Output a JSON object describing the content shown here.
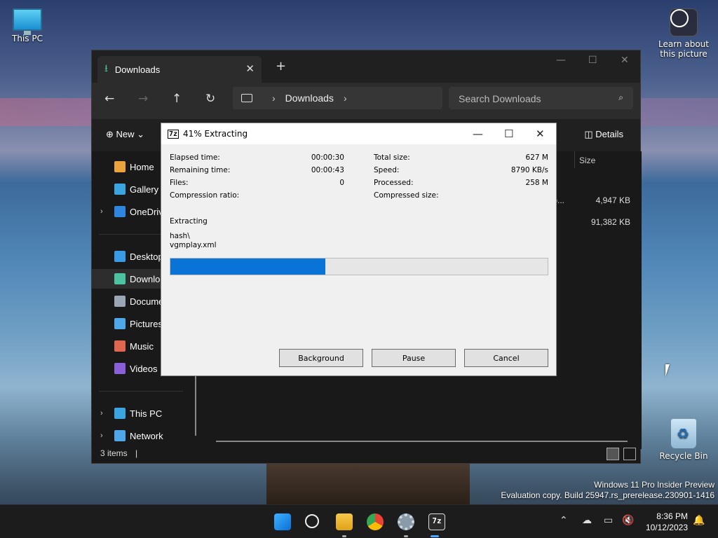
{
  "desktop": {
    "icons": {
      "this_pc": "This PC",
      "learn_about": "Learn about this picture",
      "recycle_bin": "Recycle Bin"
    }
  },
  "explorer": {
    "tab_title": "Downloads",
    "new_tab": "+",
    "address": {
      "segment": "Downloads"
    },
    "search_placeholder": "Search Downloads",
    "cmd": {
      "new_label": "New",
      "details_label": "Details"
    },
    "sidebar": [
      {
        "label": "Home",
        "color": "#e9a53c"
      },
      {
        "label": "Gallery",
        "color": "#3aa5e0"
      },
      {
        "label": "OneDrive",
        "color": "#2f86e0"
      },
      {
        "label": "Desktop",
        "color": "#3a9be5"
      },
      {
        "label": "Downloads",
        "color": "#4cc2a0"
      },
      {
        "label": "Documents",
        "color": "#9aa5b5"
      },
      {
        "label": "Pictures",
        "color": "#4da7e8"
      },
      {
        "label": "Music",
        "color": "#e0674f"
      },
      {
        "label": "Videos",
        "color": "#8a5fd8"
      },
      {
        "label": "This PC",
        "color": "#3aa5e0"
      },
      {
        "label": "Network",
        "color": "#4da7e8"
      }
    ],
    "column_size": "Size",
    "rows": [
      {
        "name_fragment": "op...",
        "size": "4,947 KB"
      },
      {
        "name_fragment": "",
        "size": "91,382 KB"
      }
    ],
    "status": "3 items"
  },
  "dialog": {
    "title": "41% Extracting",
    "logo": "7z",
    "fields": {
      "elapsed_label": "Elapsed time:",
      "elapsed": "00:00:30",
      "remaining_label": "Remaining time:",
      "remaining": "00:00:43",
      "files_label": "Files:",
      "files": "0",
      "ratio_label": "Compression ratio:",
      "ratio": "",
      "total_label": "Total size:",
      "total": "627 M",
      "speed_label": "Speed:",
      "speed": "8790 KB/s",
      "processed_label": "Processed:",
      "processed": "258 M",
      "compressed_label": "Compressed size:",
      "compressed": ""
    },
    "status": "Extracting",
    "path_line1": "hash\\",
    "path_line2": "vgmplay.xml",
    "progress": 0.41,
    "buttons": {
      "background": "Background",
      "pause": "Pause",
      "cancel": "Cancel"
    }
  },
  "watermark": {
    "line1": "Windows 11 Pro Insider Preview",
    "line2": "Evaluation copy. Build 25947.rs_prerelease.230901-1416"
  },
  "taskbar": {
    "time": "8:36 PM",
    "date": "10/12/2023"
  }
}
